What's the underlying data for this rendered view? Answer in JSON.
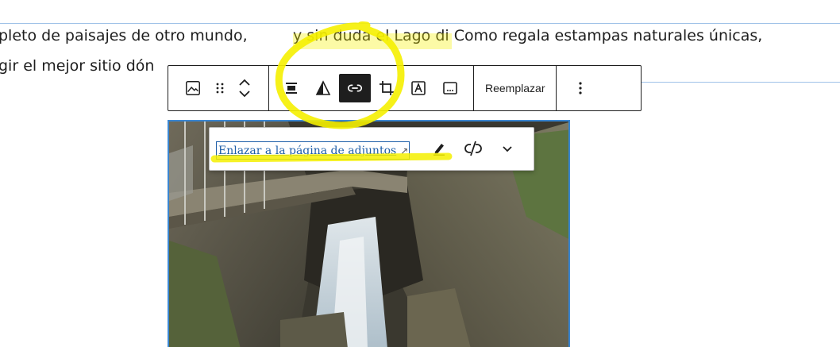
{
  "paragraph": {
    "line1_part1": "pleto de paisajes de otro mundo, ",
    "line1_part2": "y sin duda el Lago di Como regala estampas naturales únicas,",
    "line2_visible": "gir el mejor sitio dón"
  },
  "block_toolbar": {
    "block_type_icon": "image-icon",
    "drag_icon": "drag-handle-icon",
    "move_icon": "chevron-up-down-icon",
    "align_icon": "align-center-icon",
    "duotone_icon": "duotone-icon",
    "link_icon": "link-icon",
    "crop_icon": "crop-icon",
    "text_overlay_icon": "text-over-image-icon",
    "caption_icon": "caption-icon",
    "replace_label": "Reemplazar",
    "more_icon": "more-vertical-icon"
  },
  "link_popover": {
    "link_text": "Enlazar a la página de adjuntos",
    "external_glyph": "↗",
    "edit_icon": "pencil-icon",
    "unlink_icon": "unlink-icon",
    "settings_icon": "chevron-down-icon"
  },
  "colors": {
    "accent": "#3a86d1",
    "link": "#1e5ea8",
    "highlight": "#f5f000",
    "toolbar_active": "#1e1e1e"
  }
}
